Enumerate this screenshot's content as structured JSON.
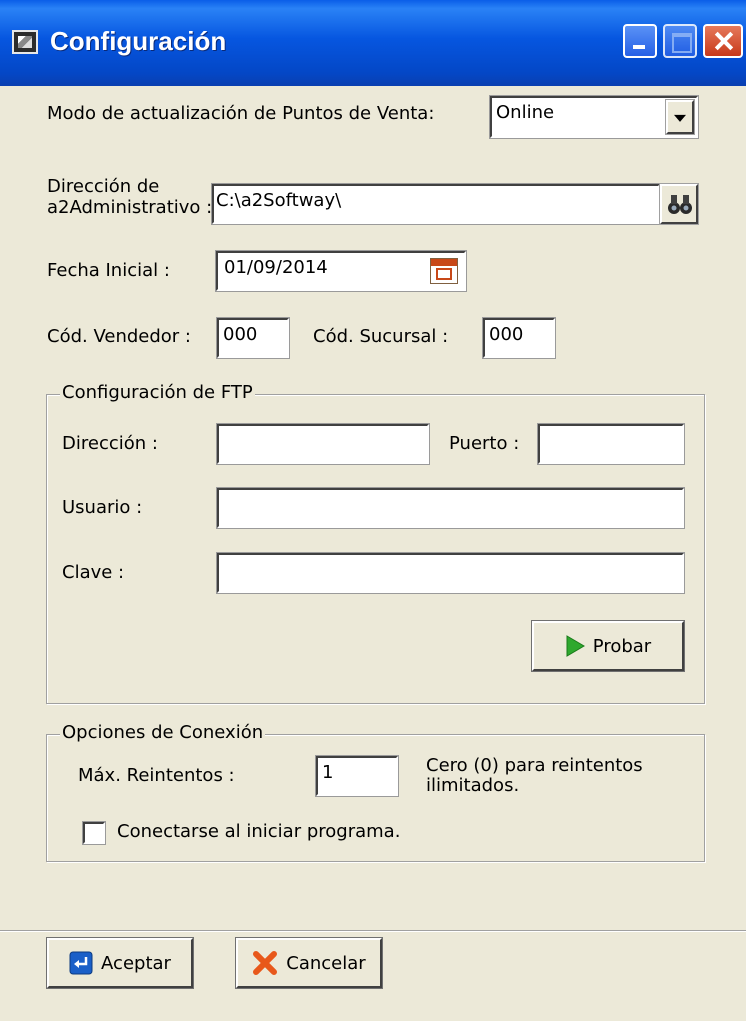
{
  "window": {
    "title": "Configuración"
  },
  "mode": {
    "label": "Modo de actualización de Puntos de Venta:",
    "value": "Online"
  },
  "admin_path": {
    "label_line1": "Dirección de",
    "label_line2": "a2Administrativo :",
    "value": "C:\\a2Softway\\"
  },
  "start_date": {
    "label": "Fecha Inicial :",
    "value": "01/09/2014"
  },
  "seller_code": {
    "label": "Cód. Vendedor :",
    "value": "000"
  },
  "branch_code": {
    "label": "Cód. Sucursal :",
    "value": "000"
  },
  "ftp": {
    "title": "Configuración de FTP",
    "address_label": "Dirección :",
    "address_value": "",
    "port_label": "Puerto :",
    "port_value": "",
    "user_label": "Usuario :",
    "user_value": "",
    "password_label": "Clave :",
    "password_value": "",
    "test_button": "Probar"
  },
  "connection": {
    "title": "Opciones de Conexión",
    "retries_label": "Máx. Reintentos :",
    "retries_value": "1",
    "hint_line1": "Cero (0) para reintentos",
    "hint_line2": "ilimitados.",
    "autoconnect_label": "Conectarse al iniciar programa.",
    "autoconnect_checked": false
  },
  "footer": {
    "accept_button": "Aceptar",
    "cancel_button": "Cancelar"
  },
  "colors": {
    "titlebar": "#0656e0",
    "dialog_bg": "#ece9d8",
    "close_button": "#c8391a",
    "play_icon": "#2ea82e",
    "cancel_icon": "#e8581a",
    "accept_icon": "#1a5fc8"
  }
}
